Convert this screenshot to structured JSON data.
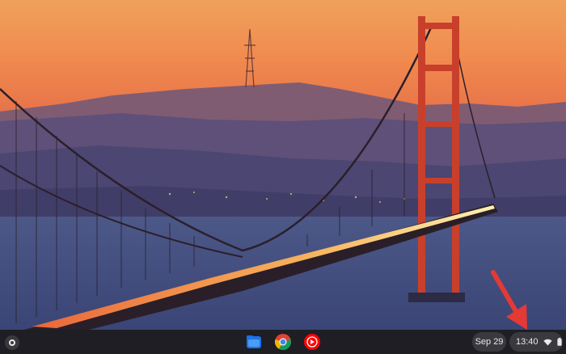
{
  "shelf": {
    "date": "Sep 29",
    "time": "13:40",
    "apps": [
      {
        "name": "files-app-icon"
      },
      {
        "name": "chrome-app-icon"
      },
      {
        "name": "youtube-music-app-icon"
      }
    ]
  },
  "colors": {
    "annotation_arrow": "#e53935",
    "sky_top": "#f2a15a",
    "bridge": "#c8402b"
  }
}
